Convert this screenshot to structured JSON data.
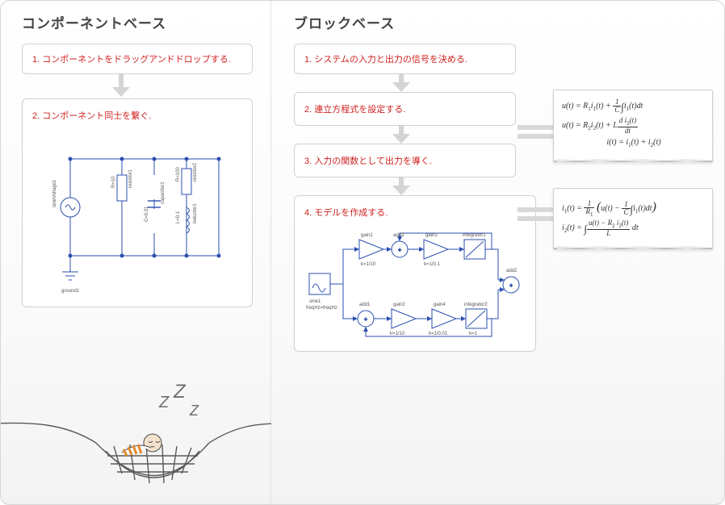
{
  "left": {
    "title": "コンポーネントベース",
    "step1": "1. コンポーネントをドラッグアンドドロップする.",
    "step2": "2. コンポーネント同士を繋ぐ.",
    "circuit": {
      "source_label": "sineVoltage1",
      "ground_label": "ground1",
      "r1_label": "resistor1",
      "r1_val": "R=10",
      "r2_label": "resistor2",
      "r2_val": "R=100",
      "c_label": "capacitor1",
      "c_val": "C=0.01",
      "l_label": "inductor1",
      "l_val": "L=0.1"
    }
  },
  "right": {
    "title": "ブロックベース",
    "step1": "1. システムの入力と出力の信号を決める.",
    "step2": "2. 連立方程式を設定する.",
    "step3": "3. 入力の関数として出力を導く.",
    "step4": "4. モデルを作成する.",
    "blocks": {
      "sine": "sine1",
      "sine_param": "freqHz=freqHz",
      "gain1": "gain1",
      "gain1_k": "k=1/10",
      "add3": "add3",
      "gain3": "gain3",
      "gain3_k": "k=1/0.1",
      "integrator1": "integrator1",
      "add1": "add1",
      "gain2": "gain2",
      "gain2_k": "k=1/10",
      "gain4": "gain4",
      "gain4_k": "k=1/0.01",
      "integrator2": "integrator2",
      "int2_k": "k=1",
      "add2": "add2"
    },
    "equations1": {
      "e1a": "u(t)  =  R",
      "e1b": "i",
      "e1c": "(t) + ",
      "e2a": "u(t)  =  R",
      "e2b": "i",
      "e2c": "(t) + L",
      "e3a": "i(t)  =  i",
      "e3b": "(t) + i",
      "e3c": "(t)"
    },
    "equations2": {
      "e1a": "i",
      "e1b": "(t) = ",
      "e2a": "i",
      "e2b": "(t) = "
    }
  },
  "illustration": {
    "zzz": "Z Z Z"
  }
}
